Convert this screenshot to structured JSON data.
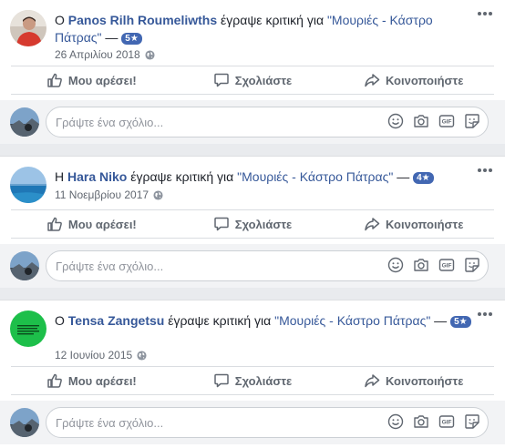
{
  "reviews": [
    {
      "prefix": "Ο ",
      "author": "Panos Rilh Roumeliwths",
      "verb": " έγραψε κριτική για ",
      "page": "\"Μουριές - Κάστρο Πάτρας\"",
      "dash": " — ",
      "rating": "5★",
      "date": "26 Απριλίου 2018"
    },
    {
      "prefix": "Η ",
      "author": "Hara Niko",
      "verb": " έγραψε κριτική για ",
      "page": "\"Μουριές - Κάστρο Πάτρας\"",
      "dash": " — ",
      "rating": "4★",
      "date": "11 Νοεμβρίου 2017"
    },
    {
      "prefix": "Ο ",
      "author": "Tensa Zangetsu",
      "verb": " έγραψε κριτική για ",
      "page": "\"Μουριές - Κάστρο Πάτρας\"",
      "dash": " — ",
      "rating": "5★",
      "date": "12 Ιουνίου 2015"
    }
  ],
  "actions": {
    "like": "Μου αρέσει!",
    "comment": "Σχολιάστε",
    "share": "Κοινοποιήστε"
  },
  "comment_placeholder": "Γράψτε ένα σχόλιο...",
  "icons": {
    "more": "more-icon",
    "globe": "globe-icon",
    "like": "thumbs-up-icon",
    "comment": "speech-bubble-icon",
    "share": "share-arrow-icon",
    "emoji": "smiley-icon",
    "camera": "camera-icon",
    "gif": "gif-icon",
    "sticker": "sticker-icon"
  },
  "gif_label": "GIF",
  "colors": {
    "link": "#365899",
    "badge": "#4267b2",
    "meta": "#616770",
    "action": "#606770"
  }
}
